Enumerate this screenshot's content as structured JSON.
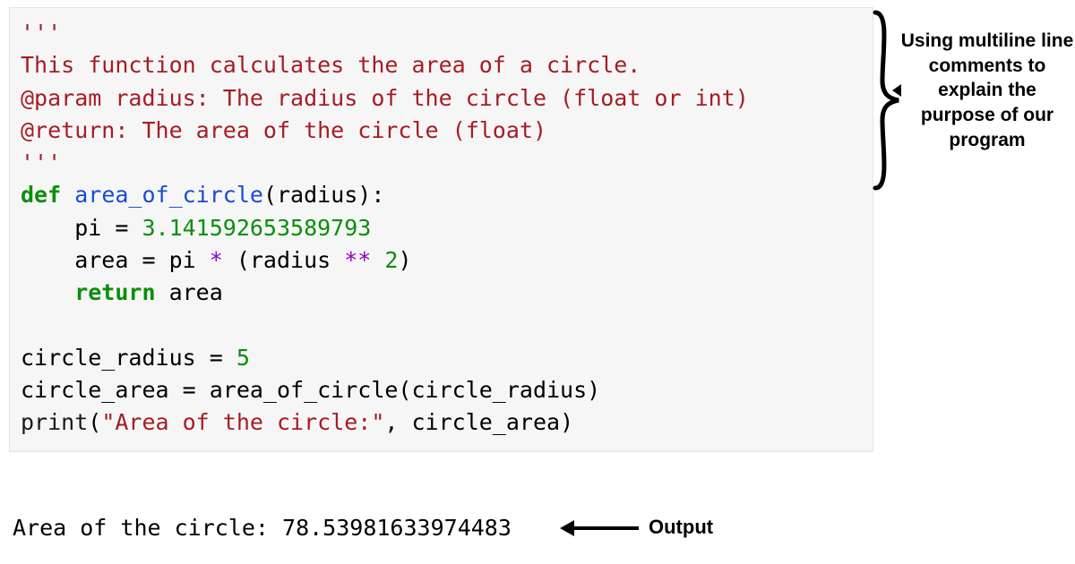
{
  "docstring": {
    "open": "'''",
    "l1": "This function calculates the area of a circle.",
    "l2": "@param radius: The radius of the circle (float or int)",
    "l3": "@return: The area of the circle (float)",
    "close": "'''"
  },
  "fn": {
    "def_kw": "def",
    "name": "area_of_circle",
    "params": "(radius):",
    "line_pi_lhs": "    pi = ",
    "pi_value": "3.141592653589793",
    "line_area_lhs": "    area = pi ",
    "op_mul": "*",
    "area_mid": " (radius ",
    "op_pow": "**",
    "area_rhs_num": "2",
    "area_rhs_close": ")",
    "return_kw": "    return",
    "return_rhs": " area"
  },
  "main": {
    "assign_radius_lhs": "circle_radius = ",
    "radius_value": "5",
    "call_line": "circle_area = area_of_circle(circle_radius)",
    "print_kw": "print",
    "print_open": "(",
    "print_str": "\"Area of the circle:\"",
    "print_rest": ", circle_area)"
  },
  "output": {
    "text": "Area of the circle: 78.53981633974483",
    "label": "Output"
  },
  "note": {
    "text": "Using multiline line comments to explain the purpose of our program"
  },
  "colors": {
    "docstring": "#a61c24",
    "keyword": "#0a8f0a",
    "function": "#1a4cd0",
    "number": "#0a8f0a",
    "operator": "#8b00c9",
    "bg": "#f6f6f6"
  }
}
